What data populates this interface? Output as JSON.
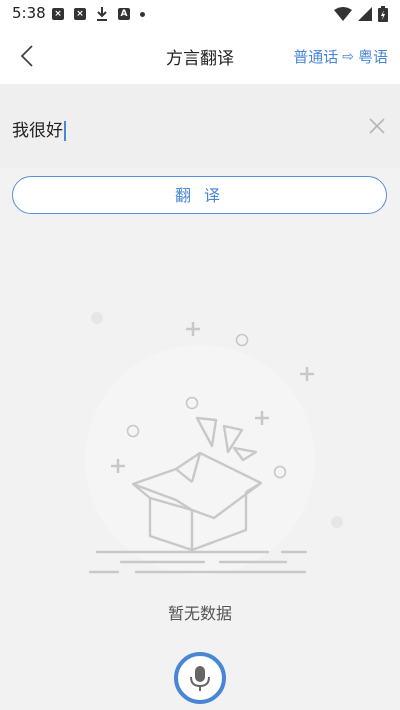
{
  "status_bar": {
    "time": "5:38"
  },
  "header": {
    "title": "方言翻译",
    "source_lang": "普通话",
    "target_lang": "粤语"
  },
  "input": {
    "value": "我很好"
  },
  "translate_button": {
    "label": "翻 译"
  },
  "empty_state": {
    "text": "暂无数据"
  },
  "icons": {
    "back": "chevron-left-icon",
    "clear": "close-icon",
    "mic": "microphone-icon",
    "switch": "arrow-right-icon",
    "illustration": "open-box-icon"
  },
  "colors": {
    "accent": "#4a86d6",
    "background": "#f2f2f2"
  }
}
